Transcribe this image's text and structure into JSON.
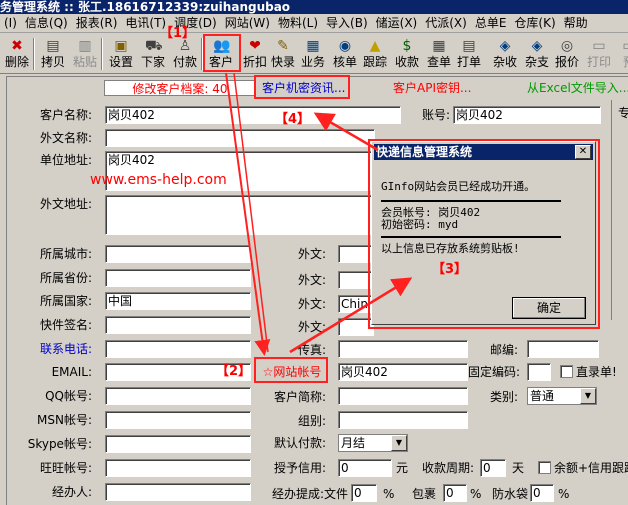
{
  "title": "务管理系统 :: 张工.18616712339:zuihangubao",
  "menu": [
    "(I)",
    "信息(Q)",
    "报表(R)",
    "电讯(T)",
    "调度(D)",
    "网站(W)",
    "物料(L)",
    "导入(B)",
    "储运(X)",
    "代派(X)",
    "总单E",
    "仓库(K)",
    "帮助"
  ],
  "toolbar": [
    {
      "label": "删除",
      "icon": "✖",
      "color": "#cc0000",
      "disabled": false
    },
    {
      "label": "拷贝",
      "icon": "▤",
      "color": "#404040",
      "disabled": false
    },
    {
      "label": "粘贴",
      "icon": "▥",
      "color": "#808080",
      "disabled": true
    },
    {
      "label": "设置",
      "icon": "▣",
      "color": "#806000",
      "disabled": false
    },
    {
      "label": "下家",
      "icon": "⛟",
      "color": "#404040",
      "disabled": false
    },
    {
      "label": "付款",
      "icon": "♙",
      "color": "#404040",
      "disabled": false
    },
    {
      "label": "客户",
      "icon": "👥",
      "color": "#008000",
      "disabled": false
    },
    {
      "label": "折扣",
      "icon": "❤",
      "color": "#cc0000",
      "disabled": false
    },
    {
      "label": "快录",
      "icon": "✎",
      "color": "#806000",
      "disabled": false
    },
    {
      "label": "业务",
      "icon": "▦",
      "color": "#004080",
      "disabled": false
    },
    {
      "label": "核单",
      "icon": "◉",
      "color": "#004080",
      "disabled": false
    },
    {
      "label": "跟踪",
      "icon": "▲",
      "color": "#c0a000",
      "disabled": false
    },
    {
      "label": "收款",
      "icon": "$",
      "color": "#006000",
      "disabled": false
    },
    {
      "label": "查单",
      "icon": "▦",
      "color": "#404040",
      "disabled": false
    },
    {
      "label": "打单",
      "icon": "▤",
      "color": "#404040",
      "disabled": false
    },
    {
      "label": "杂收",
      "icon": "◈",
      "color": "#004080",
      "disabled": false
    },
    {
      "label": "杂支",
      "icon": "◈",
      "color": "#004080",
      "disabled": false
    },
    {
      "label": "报价",
      "icon": "◎",
      "color": "#404040",
      "disabled": false
    },
    {
      "label": "打印",
      "icon": "▭",
      "color": "#808080",
      "disabled": true
    },
    {
      "label": "预",
      "icon": "▭",
      "color": "#808080",
      "disabled": true
    }
  ],
  "tabs": {
    "edit_archive": "修改客户档案: 40",
    "secret_info": "客户机密资讯...",
    "api_key": "客户API密钥...",
    "excel_import": "从Excel文件导入..."
  },
  "form": {
    "customer_name_label": "客户名称:",
    "customer_name": "岗贝402",
    "account_label": "账号:",
    "account": "岗贝402",
    "foreign_name_label": "外文名称:",
    "address_label": "单位地址:",
    "address": "岗贝402",
    "foreign_address_label": "外文地址:",
    "city_label": "所属城市:",
    "province_label": "所属省份:",
    "country_label": "所属国家:",
    "country": "中国",
    "foreign_label": "外文:",
    "foreign_country": "Chin",
    "signature_label": "快件签名:",
    "phone_label": "联系电话:",
    "fax_label": "传真:",
    "postcode_label": "邮编:",
    "email_label": "EMAIL:",
    "website_account_label": "☆网站帐号",
    "website_account": "岗贝402",
    "fixed_code_label": "固定编码:",
    "direct_label": "直录单!",
    "qq_label": "QQ帐号:",
    "short_name_label": "客户简称:",
    "category_label": "类别:",
    "category": "普通",
    "msn_label": "MSN帐号:",
    "group_label": "组别:",
    "skype_label": "Skype帐号:",
    "payment_label": "默认付款:",
    "payment": "月结",
    "wangwang_label": "旺旺帐号:",
    "credit_label": "授予信用:",
    "credit": "0",
    "yuan": "元",
    "period_label": "收款周期:",
    "period": "0",
    "day": "天",
    "balance_label": "余额+信用跟踪",
    "handler_label": "经办人:",
    "commission_label": "经办提成:文件",
    "commission_file": "0",
    "percent": "%",
    "package_label": "包裹",
    "package": "0",
    "waterproof_label": "防水袋",
    "waterproof": "0"
  },
  "dialog": {
    "title": "快递信息管理系统",
    "line1": "GInfo网站会员已经成功开通。",
    "line2": "会员帐号: 岗贝402",
    "line3": "初始密码: myd",
    "line4": "以上信息已存放系统剪贴板!",
    "ok": "确定"
  },
  "annotations": {
    "a1": "【1】",
    "a2": "【2】",
    "a3": "【3】",
    "a4": "【4】",
    "watermark": "www.ems-help.com",
    "right_frag": "专"
  }
}
